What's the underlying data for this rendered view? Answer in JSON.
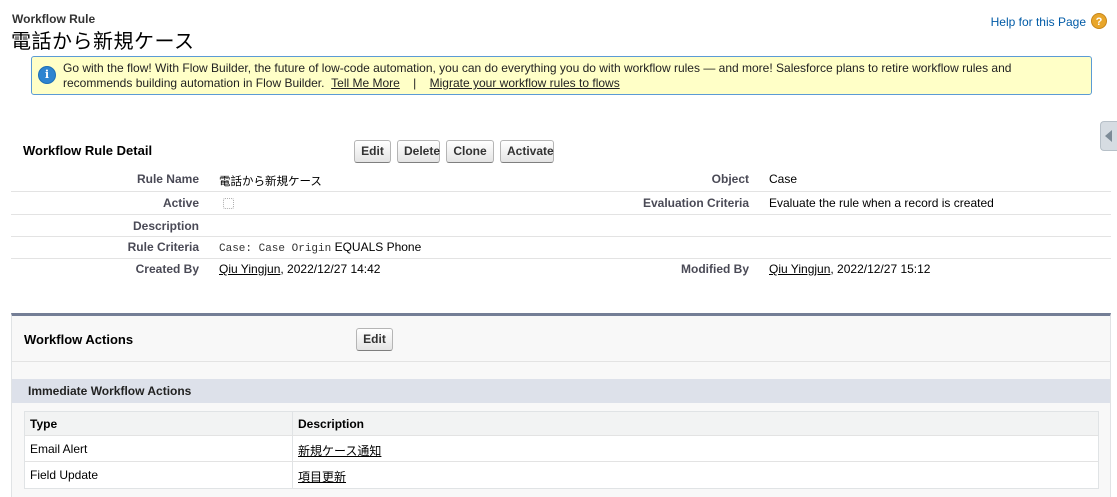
{
  "header": {
    "page_type": "Workflow Rule",
    "title": "電話から新規ケース",
    "help_link": "Help for this Page",
    "help_icon": "question-icon"
  },
  "banner": {
    "icon": "info-icon",
    "text": "Go with the flow! With Flow Builder, the future of low-code automation, you can do everything you do with workflow rules — and more! Salesforce plans to retire workflow rules and recommends building automation in Flow Builder.",
    "link1": "Tell Me More",
    "separator": "|",
    "link2": "Migrate your workflow rules to flows"
  },
  "detail": {
    "title": "Workflow Rule Detail",
    "buttons": {
      "edit": "Edit",
      "delete": "Delete",
      "clone": "Clone",
      "activate": "Activate"
    },
    "fields": {
      "rule_name_label": "Rule Name",
      "rule_name_value": "電話から新規ケース",
      "object_label": "Object",
      "object_value": "Case",
      "active_label": "Active",
      "active_value": false,
      "evaluation_label": "Evaluation Criteria",
      "evaluation_value": "Evaluate the rule when a record is created",
      "description_label": "Description",
      "description_value": "",
      "rule_criteria_label": "Rule Criteria",
      "rule_criteria_field": "Case: Case Origin",
      "rule_criteria_rest": "EQUALS Phone",
      "created_by_label": "Created By",
      "created_by_user": "Qiu Yingjun",
      "created_by_date": ", 2022/12/27 14:42",
      "modified_by_label": "Modified By",
      "modified_by_user": "Qiu Yingjun",
      "modified_by_date": ", 2022/12/27 15:12"
    }
  },
  "actions": {
    "title": "Workflow Actions",
    "edit_button": "Edit",
    "immediate_title": "Immediate Workflow Actions",
    "columns": {
      "type": "Type",
      "description": "Description"
    },
    "rows": [
      {
        "type": "Email Alert",
        "description": "新規ケース通知"
      },
      {
        "type": "Field Update",
        "description": "項目更新"
      }
    ]
  }
}
